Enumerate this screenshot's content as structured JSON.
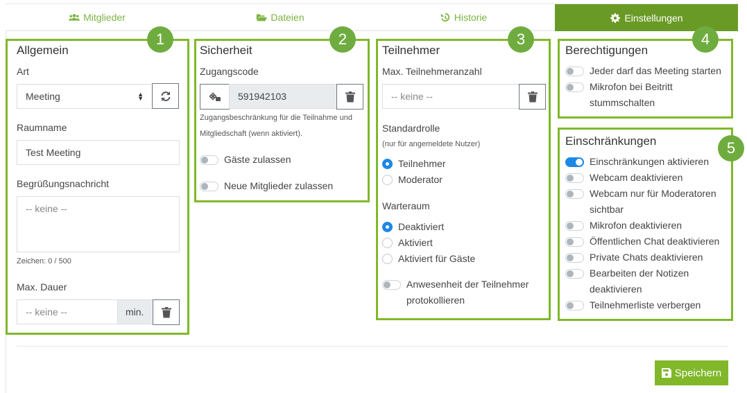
{
  "tabs": [
    {
      "label": "Mitglieder",
      "icon": "users-icon",
      "active": false
    },
    {
      "label": "Dateien",
      "icon": "folder-open-icon",
      "active": false
    },
    {
      "label": "Historie",
      "icon": "history-icon",
      "active": false
    },
    {
      "label": "Einstellungen",
      "icon": "gear-icon",
      "active": true
    }
  ],
  "colors": {
    "accent": "#80b82a",
    "active_tab": "#6a9a26",
    "badge": "#6fac3f",
    "toggle_on": "#1e88e5"
  },
  "badges": [
    "1",
    "2",
    "3",
    "4",
    "5"
  ],
  "general": {
    "title": "Allgemein",
    "type_label": "Art",
    "type_value": "Meeting",
    "room_name_label": "Raumname",
    "room_name_value": "Test Meeting",
    "welcome_label": "Begrüßungsnachricht",
    "welcome_placeholder": "-- keine --",
    "char_count": "Zeichen: 0 / 500",
    "max_duration_label": "Max. Dauer",
    "max_duration_placeholder": "-- keine --",
    "max_duration_unit": "min."
  },
  "security": {
    "title": "Sicherheit",
    "access_code_label": "Zugangscode",
    "access_code_value": "591942103",
    "access_code_help_1": "Zugangsbeschränkung für die Teilnahme und",
    "access_code_help_2": "Mitgliedschaft (wenn aktiviert).",
    "toggles": [
      {
        "label": "Gäste zulassen",
        "on": false
      },
      {
        "label": "Neue Mitglieder zulassen",
        "on": false
      }
    ]
  },
  "participants": {
    "title": "Teilnehmer",
    "max_label": "Max. Teilnehmeranzahl",
    "max_placeholder": "-- keine --",
    "default_role_label": "Standardrolle",
    "default_role_hint": "(nur für angemeldete Nutzer)",
    "roles": [
      {
        "label": "Teilnehmer",
        "selected": true
      },
      {
        "label": "Moderator",
        "selected": false
      }
    ],
    "waiting_room_label": "Warteraum",
    "waiting_room_options": [
      {
        "label": "Deaktiviert",
        "selected": true
      },
      {
        "label": "Aktiviert",
        "selected": false
      },
      {
        "label": "Aktiviert für Gäste",
        "selected": false
      }
    ],
    "attendance_toggle": {
      "label_1": "Anwesenheit der Teilnehmer",
      "label_2": "protokollieren",
      "on": false
    }
  },
  "permissions": {
    "title": "Berechtigungen",
    "toggles": [
      {
        "label_1": "Jeder darf das Meeting starten",
        "label_2": "",
        "on": false
      },
      {
        "label_1": "Mikrofon bei Beitritt",
        "label_2": "stummschalten",
        "on": false
      }
    ]
  },
  "restrictions": {
    "title": "Einschränkungen",
    "toggles": [
      {
        "label_1": "Einschränkungen aktivieren",
        "label_2": "",
        "on": true
      },
      {
        "label_1": "Webcam deaktivieren",
        "label_2": "",
        "on": false
      },
      {
        "label_1": "Webcam nur für Moderatoren",
        "label_2": "sichtbar",
        "on": false
      },
      {
        "label_1": "Mikrofon deaktivieren",
        "label_2": "",
        "on": false
      },
      {
        "label_1": "Öffentlichen Chat deaktivieren",
        "label_2": "",
        "on": false
      },
      {
        "label_1": "Private Chats deaktivieren",
        "label_2": "",
        "on": false
      },
      {
        "label_1": "Bearbeiten der Notizen",
        "label_2": "deaktivieren",
        "on": false
      },
      {
        "label_1": "Teilnehmerliste verbergen",
        "label_2": "",
        "on": false
      }
    ]
  },
  "save_label": "Speichern"
}
